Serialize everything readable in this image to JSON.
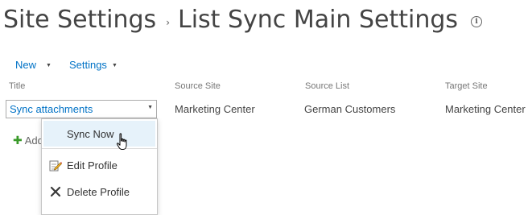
{
  "page": {
    "title_part1": "Site Settings",
    "separator": "›",
    "title_part2": "List Sync Main Settings",
    "info_icon": "i"
  },
  "toolbar": {
    "new_label": "New",
    "settings_label": "Settings"
  },
  "columns": {
    "title": "Title",
    "source_site": "Source Site",
    "source_list": "Source List",
    "target_site": "Target Site"
  },
  "row": {
    "title": "Sync attachments",
    "source_site": "Marketing Center",
    "source_list": "German Customers",
    "target_site": "Marketing Center"
  },
  "add_link": {
    "label": "Add"
  },
  "context_menu": {
    "sync_now": "Sync Now",
    "edit_profile": "Edit Profile",
    "delete_profile": "Delete Profile"
  },
  "colors": {
    "link_blue": "#0072c6",
    "highlight": "#e6f2fa",
    "add_green": "#3a9a2a"
  },
  "icons": {
    "info": "info-icon",
    "edit": "edit-pencil-icon",
    "delete": "delete-x-icon",
    "add": "plus-icon",
    "cursor": "hand-pointer-icon"
  }
}
